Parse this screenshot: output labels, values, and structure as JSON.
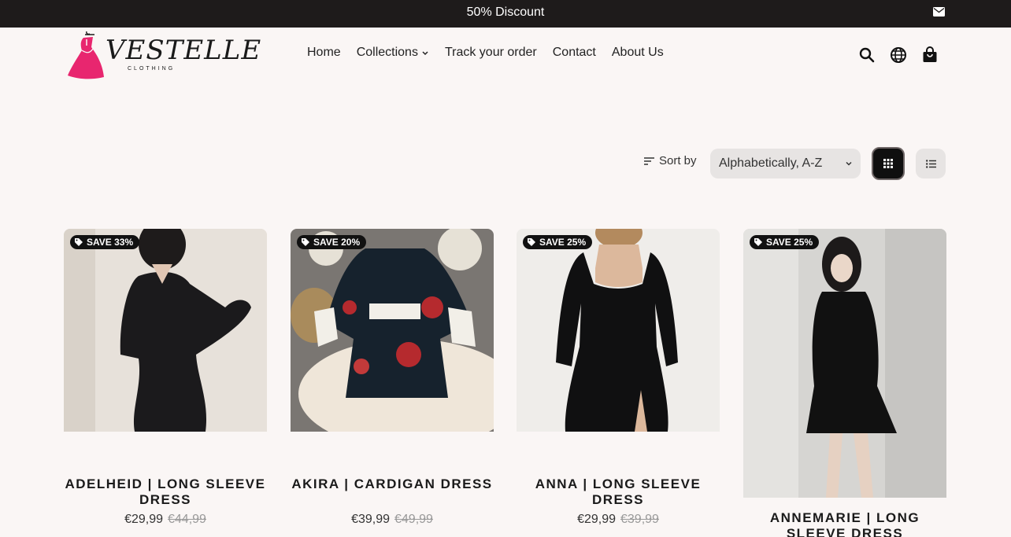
{
  "announcement": {
    "text": "50% Discount"
  },
  "brand": {
    "name": "VESTELLE",
    "tagline": "CLOTHING",
    "accent": "#e8266f"
  },
  "nav": {
    "items": [
      {
        "label": "Home"
      },
      {
        "label": "Collections"
      },
      {
        "label": "Track your order"
      },
      {
        "label": "Contact"
      },
      {
        "label": "About Us"
      }
    ]
  },
  "header_icons": [
    "search-icon",
    "globe-icon",
    "shopping-bag-icon"
  ],
  "sort": {
    "label": "Sort by",
    "value": "Alphabetically, A-Z"
  },
  "products": [
    {
      "badge": "SAVE 33%",
      "title": "ADELHEID | LONG SLEEVE DRESS",
      "price": "€29,99",
      "compare_price": "€44,99"
    },
    {
      "badge": "SAVE 20%",
      "title": "AKIRA | CARDIGAN DRESS",
      "price": "€39,99",
      "compare_price": "€49,99"
    },
    {
      "badge": "SAVE 25%",
      "title": "ANNA | LONG SLEEVE DRESS",
      "price": "€29,99",
      "compare_price": "€39,99"
    },
    {
      "badge": "SAVE 25%",
      "title": "ANNEMARIE | LONG SLEEVE DRESS",
      "price": "",
      "compare_price": ""
    }
  ]
}
